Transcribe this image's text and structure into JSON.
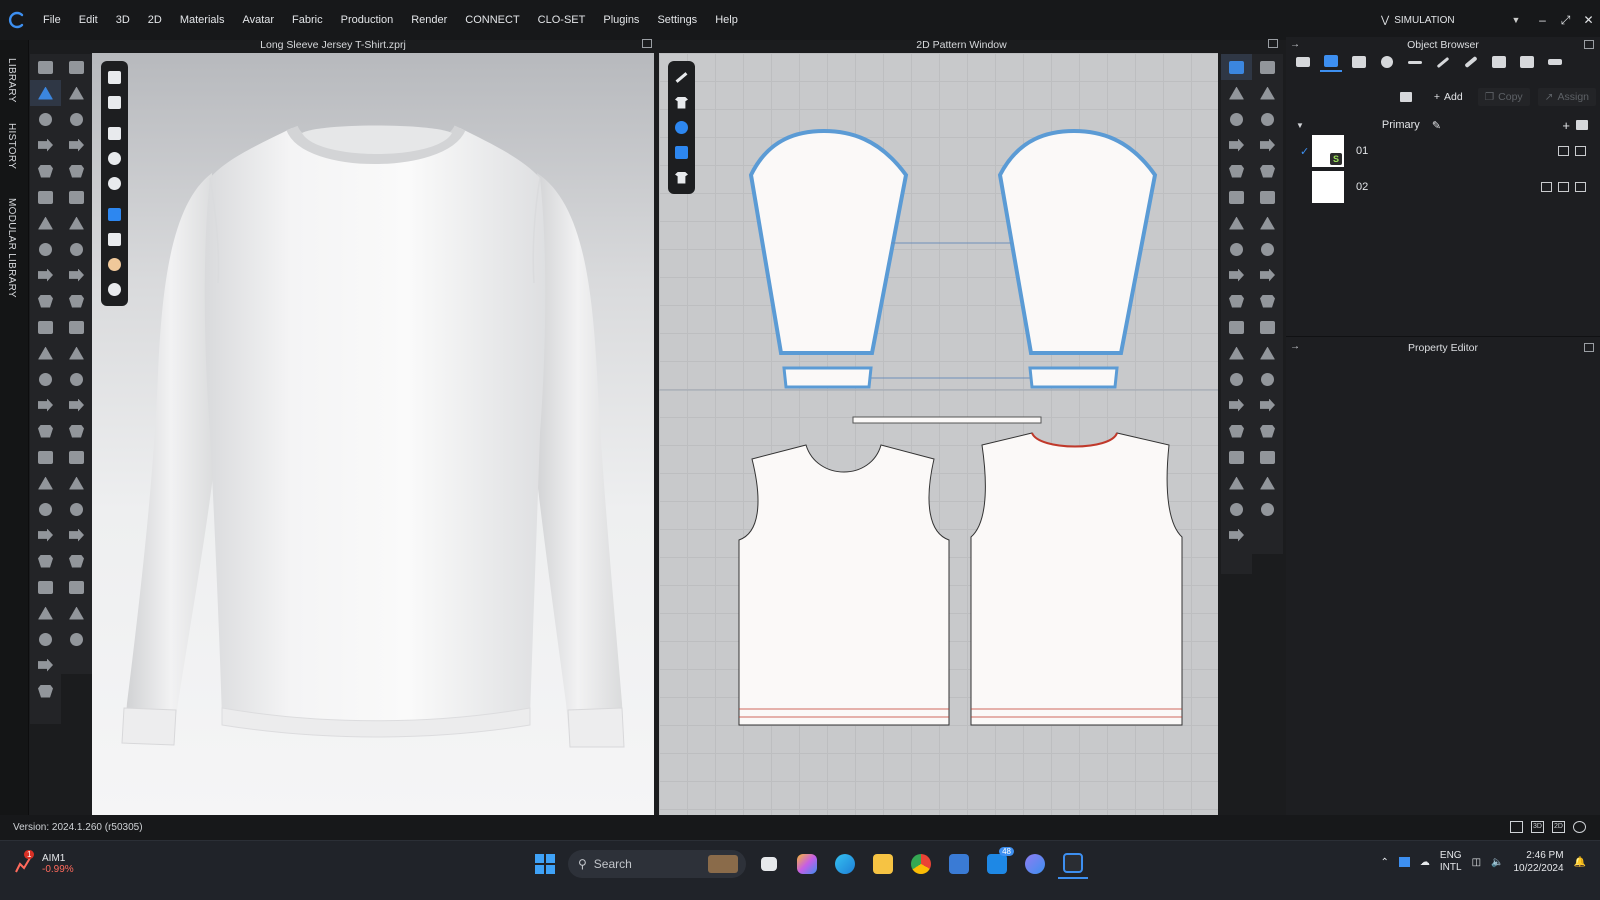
{
  "menubar": {
    "items": [
      "File",
      "Edit",
      "3D",
      "2D",
      "Materials",
      "Avatar",
      "Fabric",
      "Production",
      "Render",
      "CONNECT",
      "CLO-SET",
      "Plugins",
      "Settings",
      "Help"
    ],
    "mode_label": "SIMULATION"
  },
  "left_tabs": [
    "LIBRARY",
    "HISTORY",
    "MODULAR LIBRARY"
  ],
  "viewport3d": {
    "title": "Long Sleeve Jersey T-Shirt.zprj"
  },
  "viewport2d": {
    "title": "2D Pattern Window"
  },
  "object_browser": {
    "title": "Object Browser",
    "add_label": "Add",
    "copy_label": "Copy",
    "assign_label": "Assign",
    "section_label": "Primary",
    "colorways": [
      {
        "name": "01",
        "selected": true
      },
      {
        "name": "02",
        "selected": false
      }
    ]
  },
  "property_editor": {
    "title": "Property Editor"
  },
  "status": {
    "version": "Version: 2024.1.260 (r50305)",
    "view_modes": [
      "3D",
      "2D"
    ]
  },
  "taskbar": {
    "stock_name": "AIM1",
    "stock_change": "-0.99%",
    "stock_badge": "1",
    "search_placeholder": "Search",
    "mail_badge": "48",
    "lang_top": "ENG",
    "lang_bottom": "INTL",
    "time": "2:46 PM",
    "date": "10/22/2024"
  },
  "colors": {
    "accent": "#3d8ff0",
    "pattern_outline": "#5b9bd5",
    "seam_red": "#c0392b",
    "stock_negative": "#ff6a5c"
  }
}
